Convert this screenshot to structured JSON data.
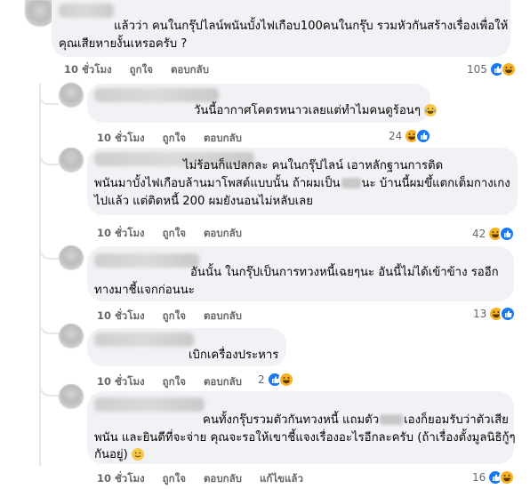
{
  "comments": [
    {
      "id": "c1",
      "text_lines": [
        "แล้วว่า คนในกรุ๊ปไลน์พนันบั้งไฟเกือบ100คนในกรุ๊บ รวมหัวกันสร้างเรื่องเพื่อให้",
        "คุณเสียหายงั้นเหรอครับ ?"
      ],
      "time": "10 ชั่วโมง",
      "like_label": "ถูกใจ",
      "reply_label": "ตอบกลับ",
      "reaction_count": "105",
      "reactions": [
        "like",
        "haha"
      ]
    },
    {
      "id": "c2",
      "text_lines": [
        "วันนี้อากาศโคตรหนาวเลยแต่ทำไมคนดูร้อนๆ"
      ],
      "time": "10 ชั่วโมง",
      "like_label": "ถูกใจ",
      "reply_label": "ตอบกลับ",
      "reaction_count": "24",
      "reactions": [
        "haha",
        "like"
      ]
    },
    {
      "id": "c3",
      "text_lines": [
        "ไม่ร้อนก็แปลกละ คนในกรุ๊ปไลน์ เอาหลักฐานการติด",
        "พนันมาบั้งไฟเกือบล้านมาโพสต์แบบนั้น ถ้าผมเป็น",
        "ไปแล้ว แต่ติดหนี้ 200 ผมยังนอนไม่หลับเลย"
      ],
      "text_line2_after": "นะ บ้านนี้ผมขึ้แตกเต็มกางเกง",
      "time": "10 ชั่วโมง",
      "like_label": "ถูกใจ",
      "reply_label": "ตอบกลับ",
      "reaction_count": "42",
      "reactions": [
        "haha",
        "like"
      ]
    },
    {
      "id": "c4",
      "text_lines": [
        "อันนั้น ในกรุ๊ปเป็นการทวงหนี้เฉยๆนะ อันนี้ไม่ได้เข้าข้าง รออีก",
        "ทางมาชี้แจกก่อนนะ"
      ],
      "time": "10 ชั่วโมง",
      "like_label": "ถูกใจ",
      "reply_label": "ตอบกลับ",
      "reaction_count": "13",
      "reactions": [
        "haha",
        "like"
      ]
    },
    {
      "id": "c5",
      "text_lines": [
        "เบิกเครื่องประหาร"
      ],
      "time": "10 ชั่วโมง",
      "like_label": "ถูกใจ",
      "reply_label": "ตอบกลับ",
      "reaction_count": "2",
      "reactions": [
        "like",
        "haha"
      ]
    },
    {
      "id": "c6",
      "text_lines": [
        "คนทั้งกรุ๊บรวมตัวกันทวงหนี้ แถมตัว",
        "พนัน และยินดีที่จะจ่าย คุณจะรอให้เขาชี้แจงเรื่องอะไรอีกละครับ (ถ้าเรื่องตั้งมูลนิธิกู้ๆ",
        "กันอยู่)"
      ],
      "text_line1_after": "เองก็ยอมรับว่าตัวเสีย",
      "time": "10 ชั่วโมง",
      "like_label": "ถูกใจ",
      "reply_label": "ตอบกลับ",
      "edited_label": "แก้ไขแล้ว",
      "reaction_count": "16",
      "reactions": [
        "like",
        "haha"
      ]
    }
  ]
}
